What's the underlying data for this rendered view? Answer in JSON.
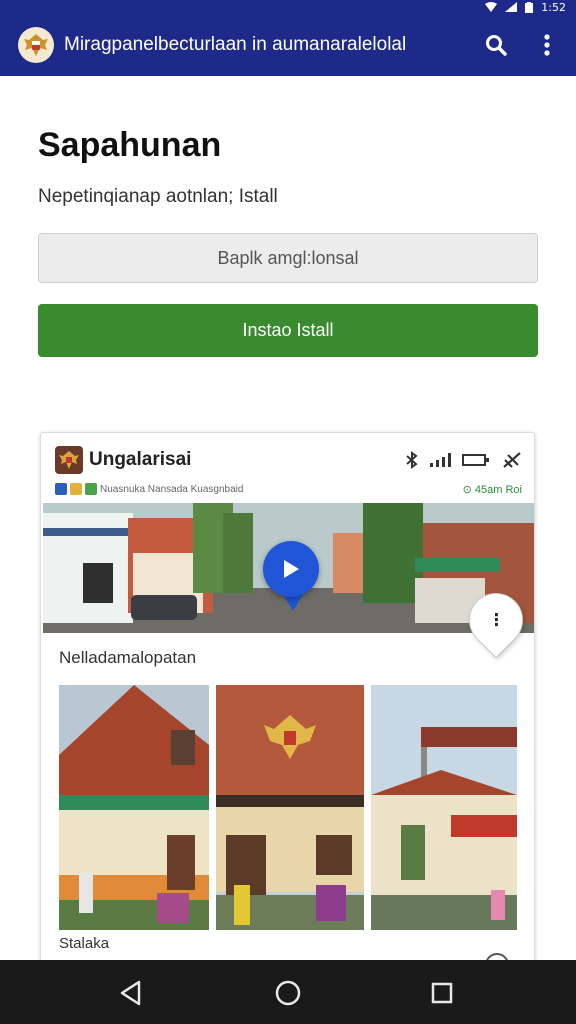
{
  "status_bar": {
    "time": "1:52"
  },
  "app_bar": {
    "title": "Miragpanelbecturlaan in aumanaralelolal"
  },
  "page": {
    "heading": "Sapahunan",
    "subtitle": "Nepetinqianap aotnlan; Istall",
    "secondary_button": "Baplk amgl:lonsal",
    "primary_button": "Instao Istall"
  },
  "card": {
    "name": "Ungalarisai",
    "subtitle": "Nuasnuka Nansada Kuasgnbaid",
    "meta": "⊙ 45am Roi",
    "caption": "Nelladamalopatan",
    "footer": "Stalaka"
  },
  "colors": {
    "app_bar": "#1d2a8a",
    "primary_button": "#3a8a2f",
    "play_button": "#1f55d6",
    "nav_bar": "#1a1a1a"
  },
  "icons": {
    "app_logo": "garuda-emblem-icon",
    "search": "search-icon",
    "menu": "more-vertical-icon",
    "nav_back": "back-triangle-icon",
    "nav_home": "home-circle-icon",
    "nav_recent": "recent-apps-square-icon"
  }
}
